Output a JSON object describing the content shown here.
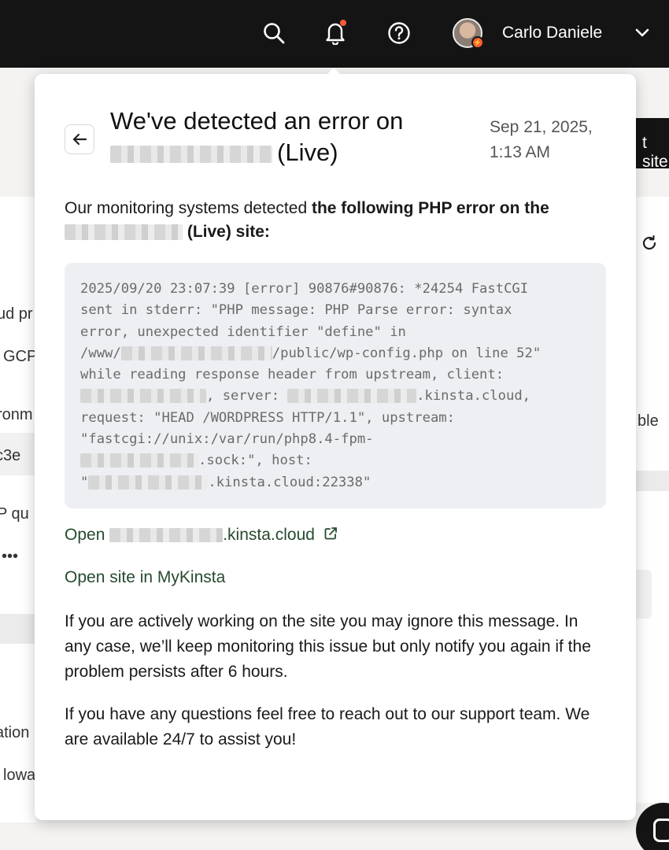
{
  "header": {
    "user_name": "Carlo Daniele",
    "icons": [
      "search-icon",
      "bell-icon",
      "help-icon",
      "chevron-down-icon"
    ],
    "notification_dot_color": "#ff5a36"
  },
  "background": {
    "fragments": [
      "ud pr",
      "GCP",
      "ronm",
      "c3e",
      "P qu",
      "•••",
      "ation",
      "lowa",
      "ble",
      "t site"
    ]
  },
  "notification": {
    "title_line1": "We've detected an error on",
    "title_live": "(Live)",
    "date_line1": "Sep 21, 2025,",
    "date_line2": "1:13 AM",
    "intro_text": "Our monitoring systems detected ",
    "intro_bold": "the following PHP error on the",
    "intro_bold_tail": "(Live) site:",
    "code": {
      "l1": "2025/09/20 23:07:39 [error] 90876#90876: *24254 FastCGI",
      "l2": "sent in stderr: \"PHP message: PHP Parse error: syntax",
      "l3": "error, unexpected identifier \"define\" in",
      "l4a": "/www/",
      "l4b": "/public/wp-config.php on line 52\"",
      "l5": "while reading response header from upstream, client:",
      "l6a": ", server:",
      "l6b": ".kinsta.cloud,",
      "l7": "request: \"HEAD /WORDPRESS HTTP/1.1\", upstream:",
      "l8": "\"fastcgi://unix:/var/run/php8.4-fpm-",
      "l9a": ".sock:\", host:",
      "l10a": "\"",
      "l10b": ".kinsta.cloud:22338\""
    },
    "open_link_prefix": "Open",
    "open_link_suffix": ".kinsta.cloud",
    "mykinsta_link": "Open site in MyKinsta",
    "paragraph1": "If you are actively working on the site you may ignore this message. In any case, we’ll keep monitoring this issue but only notify you again if the problem persists after 6 hours.",
    "paragraph2": "If you have any questions feel free to reach out to our support team. We are available 24/7 to assist you!"
  }
}
